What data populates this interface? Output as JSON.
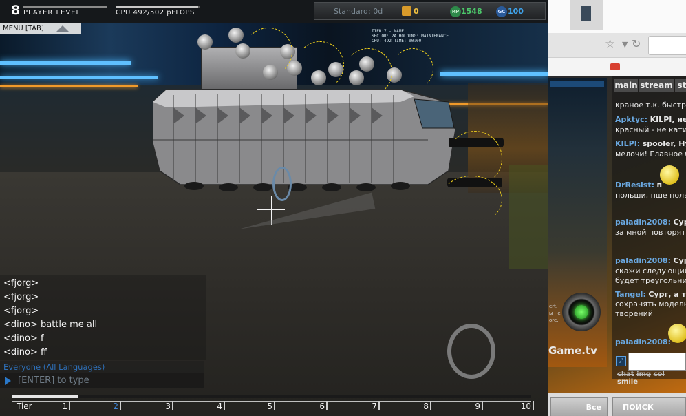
{
  "game": {
    "hud": {
      "player_level_value": "8",
      "player_level_label": "PLAYER LEVEL",
      "cpu_label": "CPU 492/502 pFLOPS",
      "cpu_fill_fraction": 0.98,
      "standard_label": "Standard: 0d",
      "coins_value": "0",
      "rp_icon_text": "RP",
      "rp_value": "1548",
      "gc_icon_text": "GC",
      "gc_value": "100"
    },
    "menu_label": "MENU [TAB]",
    "hologram_lines": [
      "TIER:7 - NAME",
      "SECTOR: 2A  HOLDING: MAINTENANCE",
      "CPU: 492  TIME: 00:00"
    ],
    "chat": {
      "lines": [
        "<fjorg>",
        "<fjorg>",
        "<fjorg>",
        "<dino> battle me all",
        "<dino> f",
        "<dino> ff"
      ],
      "channel": "Everyone (All Languages)",
      "input_placeholder": "[ENTER] to type"
    },
    "tier_bar": {
      "label": "Tier",
      "numbers": [
        "1",
        "2",
        "3",
        "4",
        "5",
        "6",
        "7",
        "8",
        "9",
        "10"
      ],
      "active": "2"
    },
    "colors": {
      "cpu_text": "#e8e8e8",
      "rp_green": "#4cc86a",
      "gc_blue": "#3fa6f0",
      "coin_gold": "#f0c040",
      "channel_blue": "#2e6fb8",
      "tier_active": "#3f86d8",
      "trajectory_yellow": "#f2d21c"
    }
  },
  "browser": {
    "icons": [
      "star-icon",
      "dropdown-icon",
      "reload-icon"
    ],
    "stream": {
      "side_texts": [
        "ert.",
        "ы не",
        "ore."
      ],
      "site_name": "Game.tv"
    },
    "chat_tabs": [
      "main",
      "stream",
      "st"
    ],
    "messages": [
      {
        "user": "",
        "text": "краное т.к. быстрее"
      },
      {
        "user": "Apktyc:",
        "text": "KILPI, нео",
        "text2": "красный - не катит."
      },
      {
        "user": "KILPI:",
        "text": "spooler, Ну",
        "text2": "мелочи! Главное ба"
      },
      {
        "user": "DrResist:",
        "text": "п",
        "text2": "польши, пше польш"
      },
      {
        "user": "paladin2008:",
        "text": "Сург",
        "text2": "за мной повторять"
      },
      {
        "user": "paladin2008:",
        "text": "Сург",
        "text2": "скажи следующий с",
        "text3": "будет треугольника"
      },
      {
        "user": "Tangel:",
        "text": "Сург, а ту",
        "text2": "сохранять модельк",
        "text3": "творений"
      },
      {
        "user": "paladin2008:",
        "text": ""
      }
    ],
    "chat_tools": [
      "chat",
      "img",
      "col",
      "smile"
    ],
    "bottom": {
      "all_label": "Все",
      "search_label": "ПОИСК"
    }
  }
}
